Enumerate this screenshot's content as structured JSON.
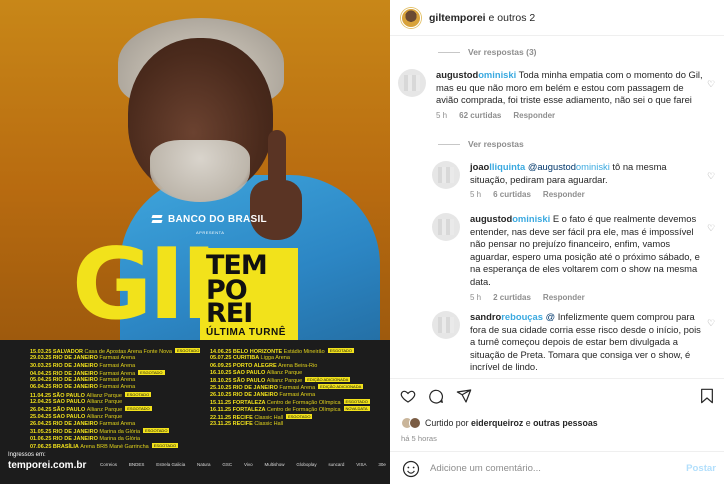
{
  "poster": {
    "sponsor": "BANCO DO BRASIL",
    "sponsor_sub": "APRESENTA",
    "artist": "GIL",
    "title_lines": [
      "TEM",
      "PO",
      "REI"
    ],
    "subtitle": "ÚLTIMA TURNÊ",
    "dates_left": [
      {
        "d": "15.03.25",
        "c": "SALVADOR",
        "v": "Casa de Apostas Arena Fonte Nova",
        "tag": "ESGOTADO"
      },
      {
        "d": "29.03.25",
        "c": "RIO DE JANEIRO",
        "v": "Farmasi Arena",
        "tag": ""
      },
      {
        "d": "30.03.25",
        "c": "RIO DE JANEIRO",
        "v": "Farmasi Arena",
        "tag": ""
      },
      {
        "d": "04.04.25",
        "c": "RIO DE JANEIRO",
        "v": "Farmasi Arena",
        "tag": "ESGOTADO"
      },
      {
        "d": "05.04.25",
        "c": "RIO DE JANEIRO",
        "v": "Farmasi Arena",
        "tag": ""
      },
      {
        "d": "06.04.25",
        "c": "RIO DE JANEIRO",
        "v": "Farmasi Arena",
        "tag": ""
      },
      {
        "d": "11.04.25",
        "c": "SÃO PAULO",
        "v": "Allianz Parque",
        "tag": "ESGOTADO"
      },
      {
        "d": "12.04.25",
        "c": "SÃO PAULO",
        "v": "Allianz Parque",
        "tag": ""
      },
      {
        "d": "26.04.25",
        "c": "SÃO PAULO",
        "v": "Allianz Parque",
        "tag": "ESGOTADO"
      },
      {
        "d": "25.04.25",
        "c": "SÃO PAULO",
        "v": "Allianz Parque",
        "tag": ""
      },
      {
        "d": "26.04.25",
        "c": "RIO DE JANEIRO",
        "v": "Farmasi Arena",
        "tag": ""
      },
      {
        "d": "31.05.25",
        "c": "RIO DE JANEIRO",
        "v": "Marina da Glória",
        "tag": "ESGOTADO"
      },
      {
        "d": "01.06.25",
        "c": "RIO DE JANEIRO",
        "v": "Marina da Glória",
        "tag": ""
      },
      {
        "d": "07.06.25",
        "c": "BRASÍLIA",
        "v": "Arena BRB Mané Garrincha",
        "tag": "ESGOTADO"
      }
    ],
    "dates_right": [
      {
        "d": "14.06.25",
        "c": "BELO HORIZONTE",
        "v": "Estádio Mineirão",
        "tag": "ESGOTADO"
      },
      {
        "d": "05.07.25",
        "c": "CURITIBA",
        "v": "Ligga Arena",
        "tag": ""
      },
      {
        "d": "06.09.25",
        "c": "PORTO ALEGRE",
        "v": "Arena Beira-Rio",
        "tag": ""
      },
      {
        "d": "16.10.25",
        "c": "SÃO PAULO",
        "v": "Allianz Parque",
        "tag": ""
      },
      {
        "d": "18.10.25",
        "c": "SÃO PAULO",
        "v": "Allianz Parque",
        "tag": "EDIÇÃO ADICIONADA"
      },
      {
        "d": "25.10.25",
        "c": "RIO DE JANEIRO",
        "v": "Farmasi Arena",
        "tag": "EDIÇÃO ADICIONADA"
      },
      {
        "d": "26.10.25",
        "c": "RIO DE JANEIRO",
        "v": "Farmasi Arena",
        "tag": ""
      },
      {
        "d": "15.11.25",
        "c": "FORTALEZA",
        "v": "Centro de Formação Olímpica",
        "tag": "ESGOTADO"
      },
      {
        "d": "16.11.25",
        "c": "FORTALEZA",
        "v": "Centro de Formação Olímpica",
        "tag": "NOVA DATA"
      },
      {
        "d": "22.11.25",
        "c": "RECIFE",
        "v": "Classic Hall",
        "tag": "ESGOTADO"
      },
      {
        "d": "23.11.25",
        "c": "RECIFE",
        "v": "Classic Hall",
        "tag": ""
      }
    ],
    "tickets_label": "Ingressos em:",
    "tickets_url": "temporei.com.br",
    "sponsors": [
      "Correios",
      "BNDES",
      "Estrela Galicia",
      "Natura",
      "GSC",
      "Vivo",
      "Multishow",
      "Globoplay",
      "suncard",
      "VISA",
      "30e"
    ]
  },
  "header": {
    "username": "giltemporei",
    "rest": " e outros 2"
  },
  "comments": {
    "replies_1": "Ver respostas (3)",
    "c1": {
      "user": "augustod",
      "user_blur": "ominiski",
      "text": " Toda minha empatia com o momento do Gil, mas eu que não moro em belém e estou com passagem de avião comprada, foi triste esse adiamento, não sei o que farei",
      "time": "5 h",
      "likes": "62 curtidas",
      "reply": "Responder"
    },
    "replies_2": "Ver respostas",
    "c2": {
      "user": "joao",
      "user_blur": "lliquinta",
      "mention": "@augustod",
      "mention_blur": "ominiski",
      "text": " tô na mesma situação, pediram para aguardar.",
      "time": "5 h",
      "likes": "6 curtidas",
      "reply": "Responder"
    },
    "c3": {
      "user": "augustod",
      "user_blur": "ominiski",
      "text": " E o fato é que realmente devemos entender, nas deve ser fácil pra ele, mas é impossível não pensar no prejuízo financeiro, enfim, vamos aguardar, espero uma posição até o próximo sábado, e na esperança de eles voltarem com o show na mesma data.",
      "time": "5 h",
      "likes": "2 curtidas",
      "reply": "Responder"
    },
    "c4": {
      "user": "sandro",
      "user_blur": "rebouças",
      "mention": "@",
      "text": " Infelizmente quem comprou para fora de sua cidade corria esse risco desde o início, pois a turnê começou depois de estar bem divulgada a situação de Preta. Tomara que consiga ver o show, é incrível de lindo.",
      "time": "",
      "likes": "",
      "reply": ""
    }
  },
  "liked": {
    "prefix": "Curtido por ",
    "user": "eiderqueiroz",
    "mid": " e ",
    "others": "outras pessoas"
  },
  "time_ago": "há 5 horas",
  "composer": {
    "placeholder": "Adicione um comentário...",
    "post": "Postar"
  },
  "colors": {
    "poster_yellow": "#f2e21b",
    "shirt_blue": "#3fa6dd",
    "redaction": "#3aa9e0",
    "post_disabled": "#b2dffc"
  }
}
